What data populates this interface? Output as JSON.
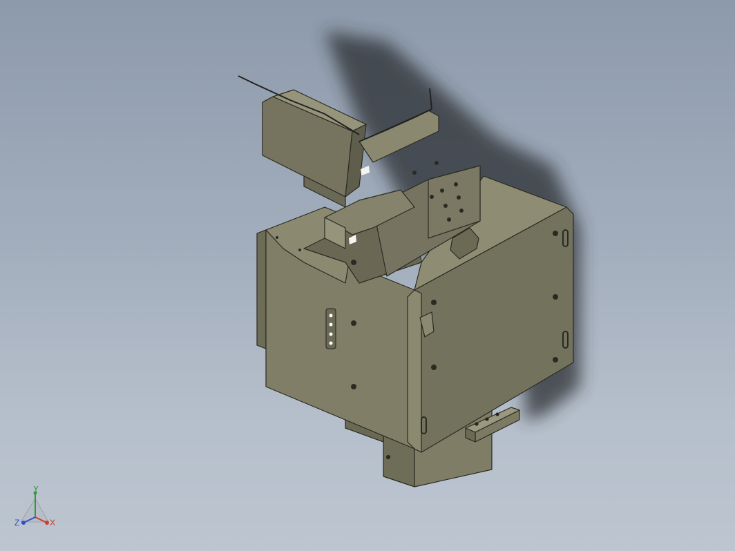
{
  "triad": {
    "x_label": "X",
    "y_label": "Y",
    "z_label": "Z",
    "x_color": "#d23a2a",
    "y_color": "#2e9a3a",
    "z_color": "#2f4fc8"
  },
  "model": {
    "body_color": "#7e7c63",
    "face_light": "#8a8870",
    "face_dark": "#5f5e4c",
    "edge_color": "#2a2a22",
    "shadow_color": "#2a2d33"
  }
}
